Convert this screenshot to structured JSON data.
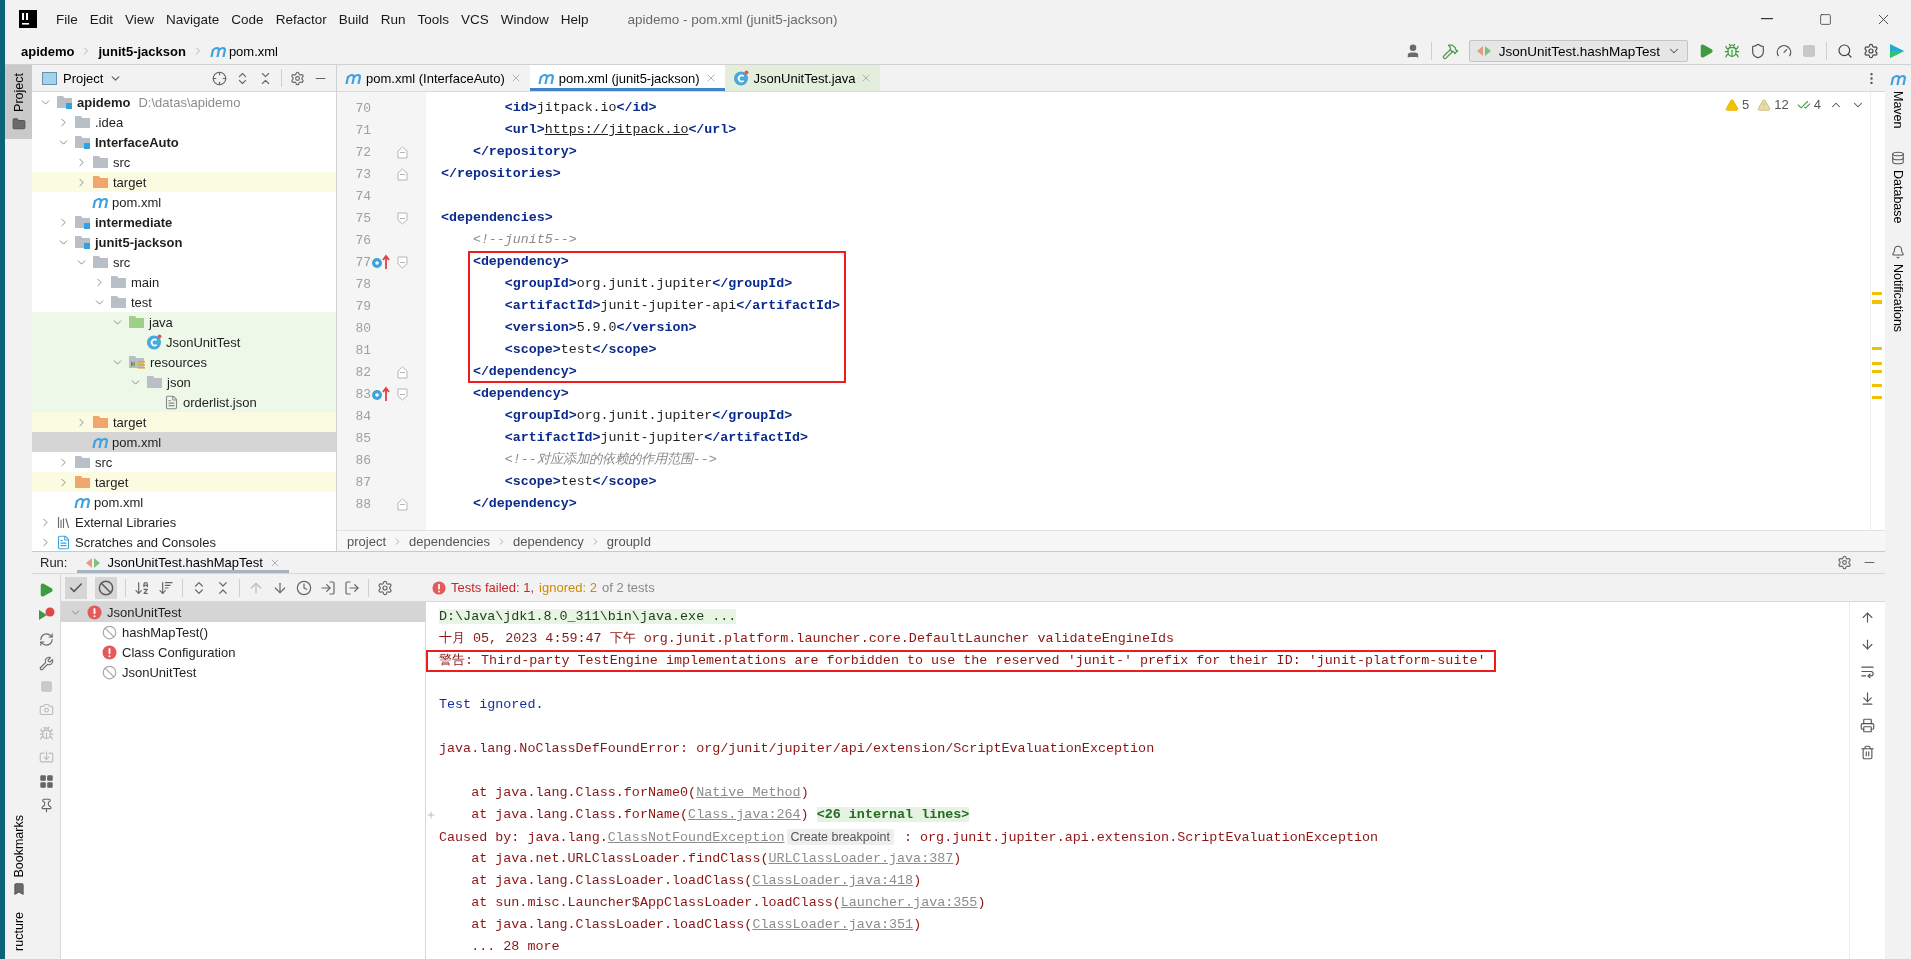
{
  "window": {
    "title": "apidemo - pom.xml (junit5-jackson)",
    "menu": [
      "File",
      "Edit",
      "View",
      "Navigate",
      "Code",
      "Refactor",
      "Build",
      "Run",
      "Tools",
      "VCS",
      "Window",
      "Help"
    ]
  },
  "navigation": {
    "crumbs": [
      {
        "label": "apidemo",
        "kind": "module"
      },
      {
        "label": "junit5-jackson",
        "kind": "module"
      },
      {
        "label": "pom.xml",
        "kind": "maven"
      }
    ],
    "run_configuration": "JsonUnitTest.hashMapTest"
  },
  "left_tool_strip": [
    {
      "label": "Project",
      "kind": "project",
      "selected": true
    },
    {
      "label": "Bookmarks",
      "kind": "bookmarks",
      "selected": false
    },
    {
      "label": "ructure",
      "kind": "structure",
      "selected": false
    }
  ],
  "right_tool_strip": [
    {
      "label": "Maven",
      "kind": "maven"
    },
    {
      "label": "Database",
      "kind": "database"
    },
    {
      "label": "Notifications",
      "kind": "notifications"
    }
  ],
  "project_panel": {
    "title": "Project",
    "tree": [
      {
        "label": "apidemo",
        "path": "D:\\datas\\apidemo",
        "kind": "module",
        "expanded": true,
        "selected": false,
        "children": [
          {
            "label": ".idea",
            "kind": "folder",
            "expanded": false,
            "selected": false
          },
          {
            "label": "InterfaceAuto",
            "kind": "module",
            "expanded": true,
            "selected": false,
            "children": [
              {
                "label": "src",
                "kind": "folder",
                "expanded": false,
                "selected": false
              },
              {
                "label": "target",
                "kind": "excluded-folder",
                "expanded": false,
                "selected": false
              },
              {
                "label": "pom.xml",
                "kind": "maven",
                "selected": false
              }
            ]
          },
          {
            "label": "intermediate",
            "kind": "module",
            "expanded": false,
            "selected": false
          },
          {
            "label": "junit5-jackson",
            "kind": "module",
            "expanded": true,
            "selected": false,
            "children": [
              {
                "label": "src",
                "kind": "folder",
                "expanded": true,
                "selected": false,
                "children": [
                  {
                    "label": "main",
                    "kind": "folder",
                    "expanded": false,
                    "selected": false
                  },
                  {
                    "label": "test",
                    "kind": "folder",
                    "expanded": true,
                    "selected": false,
                    "children": [
                      {
                        "label": "java",
                        "kind": "test-root",
                        "expanded": true,
                        "selected": false,
                        "children": [
                          {
                            "label": "JsonUnitTest",
                            "kind": "java-class",
                            "selected": false
                          }
                        ]
                      },
                      {
                        "label": "resources",
                        "kind": "test-resources",
                        "expanded": true,
                        "selected": false,
                        "children": [
                          {
                            "label": "json",
                            "kind": "folder",
                            "expanded": true,
                            "selected": false,
                            "children": [
                              {
                                "label": "orderlist.json",
                                "kind": "json",
                                "selected": false
                              }
                            ]
                          }
                        ]
                      }
                    ]
                  }
                ]
              },
              {
                "label": "target",
                "kind": "excluded-folder",
                "expanded": false,
                "selected": false
              },
              {
                "label": "pom.xml",
                "kind": "maven",
                "selected": true
              }
            ]
          },
          {
            "label": "src",
            "kind": "folder",
            "expanded": false,
            "selected": false
          },
          {
            "label": "target",
            "kind": "excluded-folder",
            "expanded": false,
            "selected": false
          },
          {
            "label": "pom.xml",
            "kind": "maven",
            "selected": false
          }
        ]
      },
      {
        "label": "External Libraries",
        "kind": "libraries",
        "expanded": false,
        "selected": false
      },
      {
        "label": "Scratches and Consoles",
        "kind": "scratches",
        "expanded": false,
        "selected": false
      }
    ]
  },
  "editor": {
    "tabs": [
      {
        "label": "pom.xml (InterfaceAuto)",
        "kind": "maven",
        "selected": false
      },
      {
        "label": "pom.xml (junit5-jackson)",
        "kind": "maven",
        "selected": true
      },
      {
        "label": "JsonUnitTest.java",
        "kind": "java-test",
        "selected": false
      }
    ],
    "inspections": [
      {
        "kind": "warning",
        "count": "5"
      },
      {
        "kind": "weak-warning",
        "count": "12"
      },
      {
        "kind": "typo",
        "count": "4"
      }
    ],
    "lines": [
      {
        "kind": "line",
        "number": "70",
        "fold_start": false,
        "fold_end": false,
        "marker": false,
        "code": [
          {
            "kind": "tag",
            "s": "        <id>"
          },
          {
            "kind": "text",
            "s": "jitpack.io"
          },
          {
            "kind": "tag",
            "s": "</id>"
          }
        ]
      },
      {
        "kind": "line",
        "number": "71",
        "fold_start": false,
        "fold_end": false,
        "marker": false,
        "code": [
          {
            "kind": "tag",
            "s": "        <url>"
          },
          {
            "kind": "link",
            "s": "https://jitpack.io"
          },
          {
            "kind": "tag",
            "s": "</url>"
          }
        ]
      },
      {
        "kind": "line",
        "number": "72",
        "fold_start": false,
        "fold_end": true,
        "marker": false,
        "code": [
          {
            "kind": "tag",
            "s": "    </repository>"
          }
        ]
      },
      {
        "kind": "line",
        "number": "73",
        "fold_start": false,
        "fold_end": true,
        "marker": false,
        "code": [
          {
            "kind": "tag",
            "s": "</repositories>"
          }
        ]
      },
      {
        "kind": "line",
        "number": "74",
        "fold_start": false,
        "fold_end": false,
        "marker": false
      },
      {
        "kind": "line",
        "number": "75",
        "fold_start": true,
        "fold_end": false,
        "marker": false,
        "code": [
          {
            "kind": "tag",
            "s": "<dependencies>"
          }
        ]
      },
      {
        "kind": "line",
        "number": "76",
        "fold_start": false,
        "fold_end": false,
        "marker": false,
        "code": [
          {
            "kind": "comment",
            "s": "    <!--junit5-->"
          }
        ]
      },
      {
        "kind": "frame",
        "lines": [
          {
            "number": "77",
            "fold_start": true,
            "fold_end": false,
            "marker": true,
            "code": [
              {
                "kind": "tag",
                "s": "    <dependency>"
              }
            ]
          },
          {
            "number": "78",
            "fold_start": false,
            "fold_end": false,
            "marker": false,
            "code": [
              {
                "kind": "tag",
                "s": "        <groupId>"
              },
              {
                "kind": "text",
                "s": "org.junit.jupiter"
              },
              {
                "kind": "tag",
                "s": "</groupId>"
              }
            ]
          },
          {
            "number": "79",
            "fold_start": false,
            "fold_end": false,
            "marker": false,
            "code": [
              {
                "kind": "tag",
                "s": "        <artifactId>"
              },
              {
                "kind": "text",
                "s": "junit-jupiter-api"
              },
              {
                "kind": "tag",
                "s": "</artifactId>"
              }
            ]
          },
          {
            "number": "80",
            "fold_start": false,
            "fold_end": false,
            "marker": false,
            "code": [
              {
                "kind": "tag",
                "s": "        <version>"
              },
              {
                "kind": "text",
                "s": "5.9.0"
              },
              {
                "kind": "tag",
                "s": "</version>"
              }
            ]
          },
          {
            "number": "81",
            "fold_start": false,
            "fold_end": false,
            "marker": false,
            "code": [
              {
                "kind": "tag",
                "s": "        <scope>"
              },
              {
                "kind": "text",
                "s": "test"
              },
              {
                "kind": "tag",
                "s": "</scope>"
              }
            ]
          },
          {
            "number": "82",
            "fold_start": false,
            "fold_end": true,
            "marker": false,
            "code": [
              {
                "kind": "tag",
                "s": "    </dependency>"
              }
            ]
          }
        ]
      },
      {
        "kind": "line",
        "number": "83",
        "fold_start": true,
        "fold_end": false,
        "marker": true,
        "code": [
          {
            "kind": "tag",
            "s": "    <dependency>"
          }
        ]
      },
      {
        "kind": "line",
        "number": "84",
        "fold_start": false,
        "fold_end": false,
        "marker": false,
        "code": [
          {
            "kind": "tag",
            "s": "        <groupId>"
          },
          {
            "kind": "text",
            "s": "org.junit.jupiter"
          },
          {
            "kind": "tag",
            "s": "</groupId>"
          }
        ]
      },
      {
        "kind": "line",
        "number": "85",
        "fold_start": false,
        "fold_end": false,
        "marker": false,
        "code": [
          {
            "kind": "tag",
            "s": "        <artifactId>"
          },
          {
            "kind": "text",
            "s": "junit-jupiter"
          },
          {
            "kind": "tag",
            "s": "</artifactId>"
          }
        ]
      },
      {
        "kind": "line",
        "number": "86",
        "fold_start": false,
        "fold_end": false,
        "marker": false,
        "code": [
          {
            "kind": "comment",
            "s": "        <!--对应添加的依赖的作用范围-->"
          }
        ]
      },
      {
        "kind": "line",
        "number": "87",
        "fold_start": false,
        "fold_end": false,
        "marker": false,
        "code": [
          {
            "kind": "tag",
            "s": "        <scope>"
          },
          {
            "kind": "text",
            "s": "test"
          },
          {
            "kind": "tag",
            "s": "</scope>"
          }
        ]
      },
      {
        "kind": "line",
        "number": "88",
        "fold_start": false,
        "fold_end": true,
        "marker": false,
        "code": [
          {
            "kind": "tag",
            "s": "    </dependency>"
          }
        ]
      }
    ],
    "breadcrumbs": [
      "project",
      "dependencies",
      "dependency",
      "groupId"
    ]
  },
  "run_panel": {
    "label": "Run:",
    "tab": "JsonUnitTest.hashMapTest",
    "filters": [
      {
        "kind": "passed",
        "on": true
      },
      {
        "kind": "ignored",
        "on": true
      }
    ],
    "status": [
      {
        "kind": "failed",
        "text": "Tests failed: 1,"
      },
      {
        "kind": "ignored",
        "text": "ignored: 2"
      },
      {
        "kind": "neutral",
        "text": "of 2 tests"
      }
    ],
    "tests": [
      {
        "label": "JsonUnitTest",
        "failed": true,
        "expanded": true,
        "selected": true,
        "children": [
          {
            "label": "hashMapTest()",
            "failed": false,
            "selected": false
          },
          {
            "label": "Class Configuration",
            "failed": true,
            "selected": false
          },
          {
            "label": "JsonUnitTest",
            "failed": false,
            "selected": false
          }
        ]
      }
    ],
    "console": [
      {
        "kind": "command",
        "boxed": false,
        "expandable": false,
        "parts": [
          {
            "kind": "text",
            "s": "D:\\Java\\jdk1.8.0_311\\bin\\java.exe ..."
          }
        ]
      },
      {
        "kind": "log",
        "boxed": false,
        "expandable": false,
        "parts": [
          {
            "kind": "text",
            "s": "十月 05, 2023 4:59:47 下午 org.junit.platform.launcher.core.DefaultLauncher validateEngineIds"
          }
        ]
      },
      {
        "kind": "log",
        "boxed": true,
        "expandable": false,
        "parts": [
          {
            "kind": "text",
            "s": "警告: Third-party TestEngine implementations are forbidden to use the reserved 'junit-' prefix for their ID: 'junit-platform-suite'"
          }
        ]
      },
      {
        "kind": "blank"
      },
      {
        "kind": "info",
        "boxed": false,
        "expandable": false,
        "parts": [
          {
            "kind": "text",
            "s": "Test ignored."
          }
        ]
      },
      {
        "kind": "blank"
      },
      {
        "kind": "error",
        "boxed": false,
        "expandable": false,
        "parts": [
          {
            "kind": "text",
            "s": "java.lang.NoClassDefFoundError: org/junit/jupiter/api/extension/ScriptEvaluationException"
          }
        ]
      },
      {
        "kind": "blank"
      },
      {
        "kind": "error",
        "boxed": false,
        "expandable": false,
        "parts": [
          {
            "kind": "text",
            "s": "    at java.lang.Class.forName0("
          },
          {
            "kind": "link",
            "s": "Native Method"
          },
          {
            "kind": "text",
            "s": ")"
          }
        ]
      },
      {
        "kind": "error",
        "boxed": false,
        "expandable": true,
        "parts": [
          {
            "kind": "text",
            "s": "    at java.lang.Class.forName("
          },
          {
            "kind": "link",
            "s": "Class.java:264"
          },
          {
            "kind": "text",
            "s": ") "
          },
          {
            "kind": "fold",
            "s": "<26 internal lines>"
          }
        ]
      },
      {
        "kind": "error",
        "boxed": false,
        "expandable": false,
        "parts": [
          {
            "kind": "text",
            "s": "Caused by: java.lang."
          },
          {
            "kind": "link",
            "s": "ClassNotFoundException"
          },
          {
            "kind": "tooltip",
            "s": "Create breakpoint"
          },
          {
            "kind": "text",
            "s": " : org.junit.jupiter.api.extension.ScriptEvaluationException"
          }
        ]
      },
      {
        "kind": "error",
        "boxed": false,
        "expandable": false,
        "parts": [
          {
            "kind": "text",
            "s": "    at java.net.URLClassLoader.findClass("
          },
          {
            "kind": "link",
            "s": "URLClassLoader.java:387"
          },
          {
            "kind": "text",
            "s": ")"
          }
        ]
      },
      {
        "kind": "error",
        "boxed": false,
        "expandable": false,
        "parts": [
          {
            "kind": "text",
            "s": "    at java.lang.ClassLoader.loadClass("
          },
          {
            "kind": "link",
            "s": "ClassLoader.java:418"
          },
          {
            "kind": "text",
            "s": ")"
          }
        ]
      },
      {
        "kind": "error",
        "boxed": false,
        "expandable": false,
        "parts": [
          {
            "kind": "text",
            "s": "    at sun.misc.Launcher$AppClassLoader.loadClass("
          },
          {
            "kind": "link",
            "s": "Launcher.java:355"
          },
          {
            "kind": "text",
            "s": ")"
          }
        ]
      },
      {
        "kind": "error",
        "boxed": false,
        "expandable": false,
        "parts": [
          {
            "kind": "text",
            "s": "    at java.lang.ClassLoader.loadClass("
          },
          {
            "kind": "link",
            "s": "ClassLoader.java:351"
          },
          {
            "kind": "text",
            "s": ")"
          }
        ]
      },
      {
        "kind": "error",
        "boxed": false,
        "expandable": false,
        "parts": [
          {
            "kind": "text",
            "s": "    ... 28 more"
          }
        ]
      }
    ]
  }
}
